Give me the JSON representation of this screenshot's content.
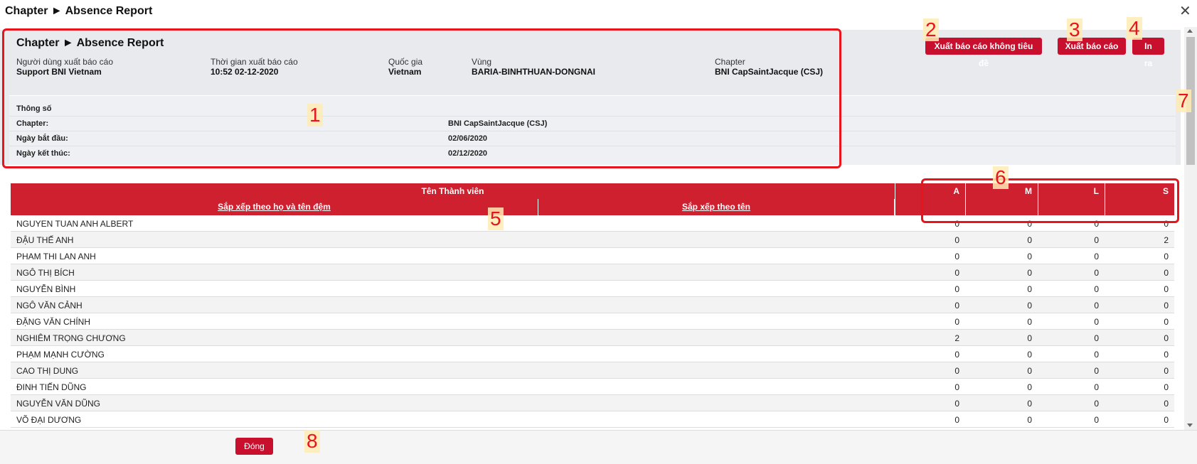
{
  "modal": {
    "title": "Chapter ► Absence Report",
    "close_label": "✕"
  },
  "report": {
    "title": "Chapter ► Absence Report",
    "meta": [
      {
        "label": "Người dùng xuất báo cáo",
        "value": "Support BNI Vietnam"
      },
      {
        "label": "Thời gian xuất báo cáo",
        "value": "10:52 02-12-2020"
      },
      {
        "label": "Quốc gia",
        "value": "Vietnam"
      },
      {
        "label": "Vùng",
        "value": "BARIA-BINHTHUAN-DONGNAI"
      },
      {
        "label": "Chapter",
        "value": "BNI CapSaintJacque (CSJ)"
      }
    ],
    "buttons": {
      "export_no_title": "Xuất báo cáo không tiêu đề",
      "export": "Xuất báo cáo",
      "print": "In ra"
    },
    "params": {
      "heading": "Thông số",
      "rows": [
        {
          "label": "Chapter:",
          "value": "BNI CapSaintJacque (CSJ)"
        },
        {
          "label": "Ngày bắt đầu:",
          "value": "02/06/2020"
        },
        {
          "label": "Ngày kết thúc:",
          "value": "02/12/2020"
        }
      ]
    }
  },
  "table": {
    "member_header": "Tên Thành viên",
    "sort_by_surname": "Sắp xếp theo họ và tên đệm",
    "sort_by_name": "Sắp xếp theo tên",
    "columns": [
      "A",
      "M",
      "L",
      "S"
    ],
    "rows": [
      {
        "name": "NGUYEN TUAN ANH ALBERT",
        "a": "0",
        "m": "0",
        "l": "0",
        "s": "0"
      },
      {
        "name": "ĐẬU THẾ ANH",
        "a": "0",
        "m": "0",
        "l": "0",
        "s": "2"
      },
      {
        "name": "PHAM THI LAN ANH",
        "a": "0",
        "m": "0",
        "l": "0",
        "s": "0"
      },
      {
        "name": "NGÔ THỊ BÍCH",
        "a": "0",
        "m": "0",
        "l": "0",
        "s": "0"
      },
      {
        "name": "NGUYỄN BÌNH",
        "a": "0",
        "m": "0",
        "l": "0",
        "s": "0"
      },
      {
        "name": "NGÔ VĂN CẢNH",
        "a": "0",
        "m": "0",
        "l": "0",
        "s": "0"
      },
      {
        "name": "ĐẶNG VĂN CHÍNH",
        "a": "0",
        "m": "0",
        "l": "0",
        "s": "0"
      },
      {
        "name": "NGHIÊM TRỌNG CHƯƠNG",
        "a": "2",
        "m": "0",
        "l": "0",
        "s": "0"
      },
      {
        "name": "PHẠM MẠNH CƯỜNG",
        "a": "0",
        "m": "0",
        "l": "0",
        "s": "0"
      },
      {
        "name": "CAO THỊ DUNG",
        "a": "0",
        "m": "0",
        "l": "0",
        "s": "0"
      },
      {
        "name": "ĐINH TIẾN  DŨNG",
        "a": "0",
        "m": "0",
        "l": "0",
        "s": "0"
      },
      {
        "name": "NGUYỄN VĂN DŨNG",
        "a": "0",
        "m": "0",
        "l": "0",
        "s": "0"
      },
      {
        "name": "VÕ ĐẠI DƯƠNG",
        "a": "0",
        "m": "0",
        "l": "0",
        "s": "0"
      }
    ]
  },
  "footer": {
    "close_label": "Đóng"
  },
  "annotations": [
    "1",
    "2",
    "3",
    "4",
    "5",
    "6",
    "7",
    "8"
  ],
  "colors": {
    "brand_red": "#cf2030",
    "annotation_red": "#e8141c"
  }
}
